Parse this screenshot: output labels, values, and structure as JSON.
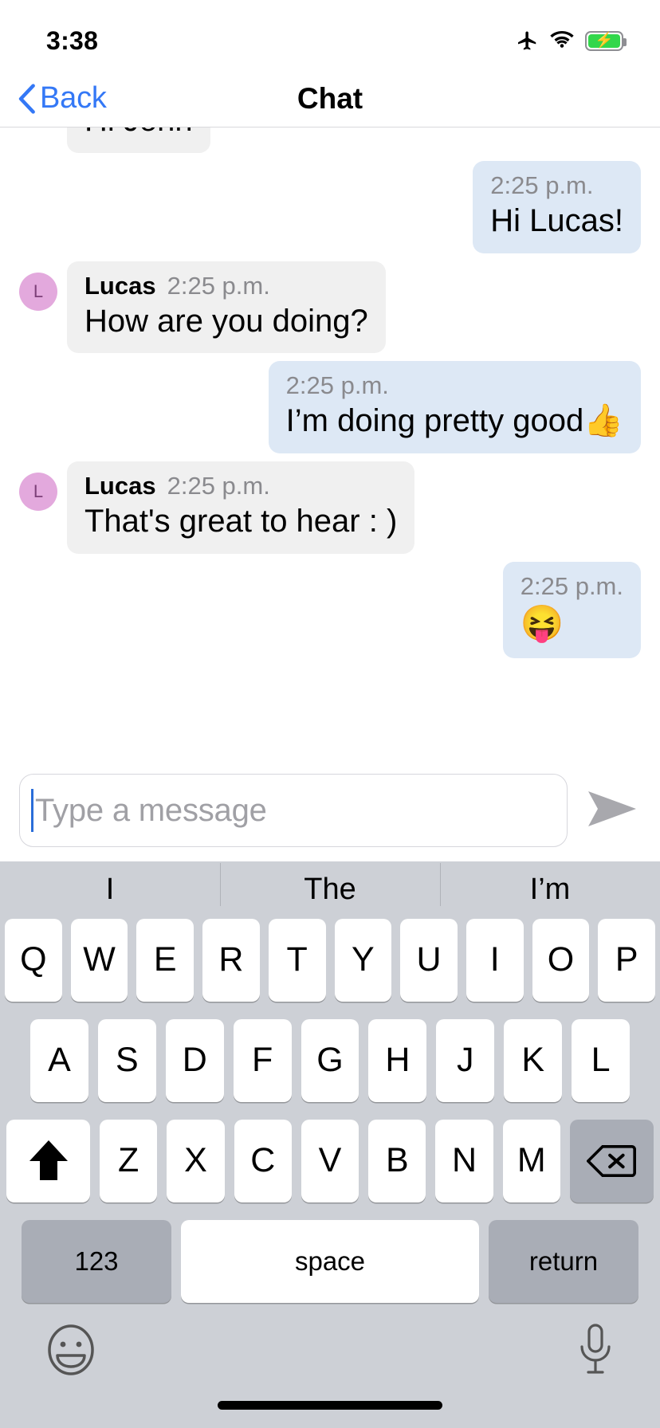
{
  "status_bar": {
    "time": "3:38",
    "icons": [
      "airplane-mode-icon",
      "wifi-icon",
      "battery-charging-icon"
    ],
    "battery_color": "#32d74b"
  },
  "nav_bar": {
    "back_label": "Back",
    "title": "Chat",
    "back_tint": "#3478f6"
  },
  "chat": {
    "messages": [
      {
        "id": "msg-1",
        "direction": "incoming",
        "sender": "",
        "time": "",
        "text": "Hi John",
        "avatar_initial": "",
        "clipped": true
      },
      {
        "id": "msg-2",
        "direction": "outgoing",
        "sender": "",
        "time": "2:25 p.m.",
        "text": "Hi Lucas!",
        "avatar_initial": ""
      },
      {
        "id": "msg-3",
        "direction": "incoming",
        "sender": "Lucas",
        "time": "2:25 p.m.",
        "text": "How are you doing?",
        "avatar_initial": "L"
      },
      {
        "id": "msg-4",
        "direction": "outgoing",
        "sender": "",
        "time": "2:25 p.m.",
        "text": "I’m doing pretty good👍",
        "avatar_initial": ""
      },
      {
        "id": "msg-5",
        "direction": "incoming",
        "sender": "Lucas",
        "time": "2:25 p.m.",
        "text": "That's great to hear : )",
        "avatar_initial": "L"
      },
      {
        "id": "msg-6",
        "direction": "outgoing",
        "sender": "",
        "time": "2:25 p.m.",
        "text": "😝",
        "avatar_initial": ""
      }
    ],
    "incoming_bubble_color": "#f0f0f0",
    "outgoing_bubble_color": "#dde8f5",
    "avatar_color": "#e3a9dd"
  },
  "composer": {
    "placeholder": "Type a message",
    "value": "",
    "send_icon": "send-arrow-icon",
    "caret_color": "#2a6dd9"
  },
  "keyboard": {
    "predictions": [
      "I",
      "The",
      "I’m"
    ],
    "row1": [
      "Q",
      "W",
      "E",
      "R",
      "T",
      "Y",
      "U",
      "I",
      "O",
      "P"
    ],
    "row2": [
      "A",
      "S",
      "D",
      "F",
      "G",
      "H",
      "J",
      "K",
      "L"
    ],
    "row3": [
      "Z",
      "X",
      "C",
      "V",
      "B",
      "N",
      "M"
    ],
    "shift_icon": "shift-arrow-icon",
    "backspace_icon": "backspace-icon",
    "numbers_label": "123",
    "space_label": "space",
    "return_label": "return",
    "emoji_icon": "emoji-face-icon",
    "mic_icon": "microphone-icon",
    "background": "#cdd0d6",
    "key_color": "#ffffff",
    "modifier_key_color": "#a9adb6"
  }
}
